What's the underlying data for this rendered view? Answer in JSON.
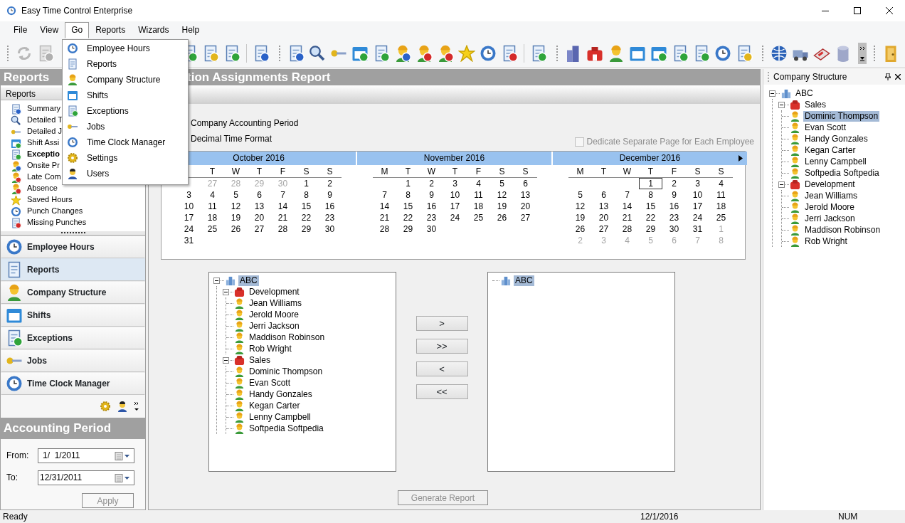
{
  "window": {
    "title": "Easy Time Control Enterprise"
  },
  "menu_bar": [
    {
      "label": "File",
      "open": false
    },
    {
      "label": "View",
      "open": false
    },
    {
      "label": "Go",
      "open": true
    },
    {
      "label": "Reports",
      "open": false
    },
    {
      "label": "Wizards",
      "open": false
    },
    {
      "label": "Help",
      "open": false
    }
  ],
  "open_menu": {
    "items": [
      {
        "label": "Employee Hours"
      },
      {
        "label": "Reports"
      },
      {
        "label": "Company Structure"
      },
      {
        "label": "Shifts"
      },
      {
        "label": "Exceptions"
      },
      {
        "label": "Jobs"
      },
      {
        "label": "Time Clock Manager"
      },
      {
        "label": "Settings"
      },
      {
        "label": "Users"
      }
    ]
  },
  "left_panel": {
    "title": "Reports",
    "subtitle": "Reports",
    "report_list": [
      {
        "label": "Summary",
        "selected": false
      },
      {
        "label": "Detailed T",
        "selected": false
      },
      {
        "label": "Detailed J",
        "selected": false
      },
      {
        "label": "Shift Assi",
        "selected": false
      },
      {
        "label": "Exceptio",
        "selected": true
      },
      {
        "label": "Onsite Pr",
        "selected": false
      },
      {
        "label": "Late Com",
        "selected": false
      },
      {
        "label": "Absence",
        "selected": false
      },
      {
        "label": "Saved Hours",
        "selected": false
      },
      {
        "label": "Punch Changes",
        "selected": false
      },
      {
        "label": "Missing Punches",
        "selected": false
      }
    ],
    "nav": [
      {
        "label": "Employee Hours",
        "selected": false
      },
      {
        "label": "Reports",
        "selected": true
      },
      {
        "label": "Company Structure",
        "selected": false
      },
      {
        "label": "Shifts",
        "selected": false
      },
      {
        "label": "Exceptions",
        "selected": false
      },
      {
        "label": "Jobs",
        "selected": false
      },
      {
        "label": "Time Clock Manager",
        "selected": false
      }
    ],
    "accounting": {
      "title": "Accounting Period",
      "from_label": "From:",
      "from": "1/  1/2011",
      "to_label": "To:",
      "to": "12/31/2011",
      "apply": {
        "label": "Apply",
        "disabled": true
      }
    }
  },
  "report": {
    "title": "tion Assignments Report",
    "options": [
      {
        "label": "Company Accounting Period"
      },
      {
        "label": "Decimal Time Format"
      }
    ],
    "dedicate": {
      "label": "Dedicate Separate Page for Each Employee",
      "checked": false,
      "disabled": true
    },
    "calendars": [
      {
        "title": "October 2016",
        "weekdays": [
          "T",
          "W",
          "T",
          "F",
          "S",
          "S"
        ],
        "weeks": [
          [
            {
              "kind": "blank"
            },
            {
              "kind": "other",
              "day": "27"
            },
            {
              "kind": "other",
              "day": "28"
            },
            {
              "kind": "other",
              "day": "29"
            },
            {
              "kind": "other",
              "day": "30"
            },
            {
              "kind": "day",
              "day": "1"
            },
            {
              "kind": "day",
              "day": "2"
            }
          ],
          [
            {
              "kind": "day",
              "day": "3"
            },
            {
              "kind": "day",
              "day": "4"
            },
            {
              "kind": "day",
              "day": "5"
            },
            {
              "kind": "day",
              "day": "6"
            },
            {
              "kind": "day",
              "day": "7"
            },
            {
              "kind": "day",
              "day": "8"
            },
            {
              "kind": "day",
              "day": "9"
            }
          ],
          [
            {
              "kind": "day",
              "day": "10"
            },
            {
              "kind": "day",
              "day": "11"
            },
            {
              "kind": "day",
              "day": "12"
            },
            {
              "kind": "day",
              "day": "13"
            },
            {
              "kind": "day",
              "day": "14"
            },
            {
              "kind": "day",
              "day": "15"
            },
            {
              "kind": "day",
              "day": "16"
            }
          ],
          [
            {
              "kind": "day",
              "day": "17"
            },
            {
              "kind": "day",
              "day": "18"
            },
            {
              "kind": "day",
              "day": "19"
            },
            {
              "kind": "day",
              "day": "20"
            },
            {
              "kind": "day",
              "day": "21"
            },
            {
              "kind": "day",
              "day": "22"
            },
            {
              "kind": "day",
              "day": "23"
            }
          ],
          [
            {
              "kind": "day",
              "day": "24"
            },
            {
              "kind": "day",
              "day": "25"
            },
            {
              "kind": "day",
              "day": "26"
            },
            {
              "kind": "day",
              "day": "27"
            },
            {
              "kind": "day",
              "day": "28"
            },
            {
              "kind": "day",
              "day": "29"
            },
            {
              "kind": "day",
              "day": "30"
            }
          ],
          [
            {
              "kind": "day",
              "day": "31"
            }
          ]
        ]
      },
      {
        "title": "November 2016",
        "weekdays": [
          "M",
          "T",
          "W",
          "T",
          "F",
          "S",
          "S"
        ],
        "weeks": [
          [
            {
              "kind": "blank"
            },
            {
              "kind": "day",
              "day": "1"
            },
            {
              "kind": "day",
              "day": "2"
            },
            {
              "kind": "day",
              "day": "3"
            },
            {
              "kind": "day",
              "day": "4"
            },
            {
              "kind": "day",
              "day": "5"
            },
            {
              "kind": "day",
              "day": "6"
            }
          ],
          [
            {
              "kind": "day",
              "day": "7"
            },
            {
              "kind": "day",
              "day": "8"
            },
            {
              "kind": "day",
              "day": "9"
            },
            {
              "kind": "day",
              "day": "10"
            },
            {
              "kind": "day",
              "day": "11"
            },
            {
              "kind": "day",
              "day": "12"
            },
            {
              "kind": "day",
              "day": "13"
            }
          ],
          [
            {
              "kind": "day",
              "day": "14"
            },
            {
              "kind": "day",
              "day": "15"
            },
            {
              "kind": "day",
              "day": "16"
            },
            {
              "kind": "day",
              "day": "17"
            },
            {
              "kind": "day",
              "day": "18"
            },
            {
              "kind": "day",
              "day": "19"
            },
            {
              "kind": "day",
              "day": "20"
            }
          ],
          [
            {
              "kind": "day",
              "day": "21"
            },
            {
              "kind": "day",
              "day": "22"
            },
            {
              "kind": "day",
              "day": "23"
            },
            {
              "kind": "day",
              "day": "24"
            },
            {
              "kind": "day",
              "day": "25"
            },
            {
              "kind": "day",
              "day": "26"
            },
            {
              "kind": "day",
              "day": "27"
            }
          ],
          [
            {
              "kind": "day",
              "day": "28"
            },
            {
              "kind": "day",
              "day": "29"
            },
            {
              "kind": "day",
              "day": "30"
            }
          ]
        ]
      },
      {
        "title": "December 2016",
        "weekdays": [
          "M",
          "T",
          "W",
          "T",
          "F",
          "S",
          "S"
        ],
        "weeks": [
          [
            {
              "kind": "blank"
            },
            {
              "kind": "blank"
            },
            {
              "kind": "blank"
            },
            {
              "kind": "today",
              "day": "1"
            },
            {
              "kind": "day",
              "day": "2"
            },
            {
              "kind": "day",
              "day": "3"
            },
            {
              "kind": "day",
              "day": "4"
            }
          ],
          [
            {
              "kind": "day",
              "day": "5"
            },
            {
              "kind": "day",
              "day": "6"
            },
            {
              "kind": "day",
              "day": "7"
            },
            {
              "kind": "day",
              "day": "8"
            },
            {
              "kind": "day",
              "day": "9"
            },
            {
              "kind": "day",
              "day": "10"
            },
            {
              "kind": "day",
              "day": "11"
            }
          ],
          [
            {
              "kind": "day",
              "day": "12"
            },
            {
              "kind": "day",
              "day": "13"
            },
            {
              "kind": "day",
              "day": "14"
            },
            {
              "kind": "day",
              "day": "15"
            },
            {
              "kind": "day",
              "day": "16"
            },
            {
              "kind": "day",
              "day": "17"
            },
            {
              "kind": "day",
              "day": "18"
            }
          ],
          [
            {
              "kind": "day",
              "day": "19"
            },
            {
              "kind": "day",
              "day": "20"
            },
            {
              "kind": "day",
              "day": "21"
            },
            {
              "kind": "day",
              "day": "22"
            },
            {
              "kind": "day",
              "day": "23"
            },
            {
              "kind": "day",
              "day": "24"
            },
            {
              "kind": "day",
              "day": "25"
            }
          ],
          [
            {
              "kind": "day",
              "day": "26"
            },
            {
              "kind": "day",
              "day": "27"
            },
            {
              "kind": "day",
              "day": "28"
            },
            {
              "kind": "day",
              "day": "29"
            },
            {
              "kind": "day",
              "day": "30"
            },
            {
              "kind": "day",
              "day": "31"
            },
            {
              "kind": "other",
              "day": "1"
            }
          ],
          [
            {
              "kind": "other",
              "day": "2"
            },
            {
              "kind": "other",
              "day": "3"
            },
            {
              "kind": "other",
              "day": "4"
            },
            {
              "kind": "other",
              "day": "5"
            },
            {
              "kind": "other",
              "day": "6"
            },
            {
              "kind": "other",
              "day": "7"
            },
            {
              "kind": "other",
              "day": "8"
            }
          ]
        ]
      }
    ],
    "available_tree": [
      {
        "label": "ABC",
        "kind": "company",
        "selected": true,
        "expanded": true,
        "children": [
          {
            "label": "Development",
            "kind": "department",
            "selected": false,
            "expanded": true,
            "children": [
              {
                "label": "Jean Williams",
                "kind": "employee",
                "selected": false
              },
              {
                "label": "Jerold Moore",
                "kind": "employee",
                "selected": false
              },
              {
                "label": "Jerri Jackson",
                "kind": "employee",
                "selected": false
              },
              {
                "label": "Maddison Robinson",
                "kind": "employee",
                "selected": false
              },
              {
                "label": "Rob Wright",
                "kind": "employee",
                "selected": false
              }
            ]
          },
          {
            "label": "Sales",
            "kind": "department",
            "selected": false,
            "expanded": true,
            "children": [
              {
                "label": "Dominic Thompson",
                "kind": "employee",
                "selected": false
              },
              {
                "label": "Evan Scott",
                "kind": "employee",
                "selected": false
              },
              {
                "label": "Handy Gonzales",
                "kind": "employee",
                "selected": false
              },
              {
                "label": "Kegan Carter",
                "kind": "employee",
                "selected": false
              },
              {
                "label": "Lenny Campbell",
                "kind": "employee",
                "selected": false
              },
              {
                "label": "Softpedia Softpedia",
                "kind": "employee",
                "selected": false
              }
            ]
          }
        ]
      }
    ],
    "transfer_buttons": [
      {
        "label": ">"
      },
      {
        "label": ">>"
      },
      {
        "label": "<"
      },
      {
        "label": "<<"
      }
    ],
    "selected_tree": [
      {
        "label": "ABC",
        "kind": "company",
        "selected": true
      }
    ],
    "generate": {
      "label": "Generate Report",
      "disabled": true
    }
  },
  "company_panel": {
    "title": "Company Structure",
    "tree": [
      {
        "label": "ABC",
        "kind": "company",
        "selected": false,
        "expanded": true,
        "children": [
          {
            "label": "Sales",
            "kind": "department",
            "selected": false,
            "expanded": true,
            "children": [
              {
                "label": "Dominic Thompson",
                "kind": "employee",
                "selected": true
              },
              {
                "label": "Evan Scott",
                "kind": "employee",
                "selected": false
              },
              {
                "label": "Handy Gonzales",
                "kind": "employee",
                "selected": false
              },
              {
                "label": "Kegan Carter",
                "kind": "employee",
                "selected": false
              },
              {
                "label": "Lenny Campbell",
                "kind": "employee",
                "selected": false
              },
              {
                "label": "Softpedia Softpedia",
                "kind": "employee",
                "selected": false
              }
            ]
          },
          {
            "label": "Development",
            "kind": "department",
            "selected": false,
            "expanded": true,
            "children": [
              {
                "label": "Jean Williams",
                "kind": "employee",
                "selected": false
              },
              {
                "label": "Jerold Moore",
                "kind": "employee",
                "selected": false
              },
              {
                "label": "Jerri Jackson",
                "kind": "employee",
                "selected": false
              },
              {
                "label": "Maddison Robinson",
                "kind": "employee",
                "selected": false
              },
              {
                "label": "Rob Wright",
                "kind": "employee",
                "selected": false
              }
            ]
          }
        ]
      }
    ]
  },
  "status_bar": {
    "message": "Ready",
    "date": "12/1/2016",
    "mode": "NUM"
  }
}
